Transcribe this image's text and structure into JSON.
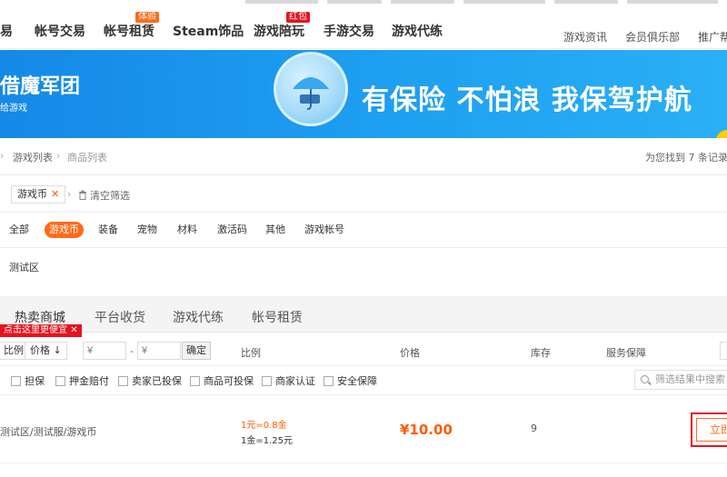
{
  "nav": {
    "items": [
      {
        "label": "易"
      },
      {
        "label": "帐号交易"
      },
      {
        "label": "帐号租赁",
        "tag": "体验"
      },
      {
        "label": "Steam饰品"
      },
      {
        "label": "游戏陪玩",
        "tag": "红包"
      },
      {
        "label": "手游交易"
      },
      {
        "label": "游戏代练"
      }
    ],
    "right": [
      "游戏资讯",
      "会员俱乐部",
      "推广帮"
    ],
    "tag_colors": {
      "体验": "#ff6a1a",
      "红包": "#e5141e"
    }
  },
  "banner": {
    "title": "借魔军团",
    "subtitle": "给游戏",
    "slogan": "有保险 不怕浪 我保驾护航",
    "bg_color": "#1c9cf0"
  },
  "breadcrumb": {
    "items": [
      "游戏列表",
      "商品列表"
    ],
    "result": "为您找到 7 条记录"
  },
  "filter": {
    "chip": "游戏币",
    "clear": "清空筛选"
  },
  "categories": {
    "items": [
      "全部",
      "游戏币",
      "装备",
      "宠物",
      "材料",
      "激活码",
      "其他",
      "游戏帐号"
    ],
    "active": "游戏币"
  },
  "zone": {
    "label": "测试区"
  },
  "tabs": [
    "热卖商城",
    "平台收货",
    "游戏代练",
    "帐号租赁"
  ],
  "promo": {
    "text": "点击这里更便宜"
  },
  "sort": {
    "ratio": "比例",
    "price": "价格",
    "min_placeholder": "¥",
    "max_placeholder": "¥",
    "separator": "-",
    "confirm": "确定",
    "columns": {
      "ratio": "比例",
      "price": "价格",
      "stock": "库存",
      "service": "服务保障"
    }
  },
  "checks": [
    "担保",
    "押金赔付",
    "卖家已投保",
    "商品可投保",
    "商家认证",
    "安全保障"
  ],
  "search": {
    "placeholder": "筛选结果中搜索"
  },
  "listing": {
    "path": "测试区/测试服/游戏币",
    "ratio_line1": "1元=0.8金",
    "ratio_line2": "1金=1.25元",
    "price": "¥10.00",
    "stock": "9",
    "buy": "立即"
  },
  "colors": {
    "accent": "#ff6a1a",
    "price": "#ff5a00",
    "highlight": "#e5141e"
  }
}
